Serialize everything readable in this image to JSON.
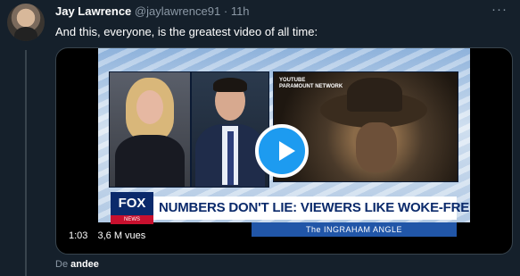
{
  "tweet": {
    "author_name": "Jay Lawrence",
    "author_handle": "@jaylawrence91",
    "separator": "·",
    "time": "11h",
    "more_icon": "more-horizontal-icon",
    "text": "And this, everyone, is the greatest video of all time:"
  },
  "video": {
    "duration": "1:03",
    "views": "3,6 M vues",
    "clip_label": "YOUTUBE\nPARAMOUNT NETWORK",
    "network_logo": "FOX",
    "network_sub": "NEWS",
    "headline": "NUMBERS DON'T LIE: VIEWERS LIKE WOKE-FREE TV",
    "show_name": "The INGRAHAM ANGLE",
    "play_icon": "play-icon"
  },
  "attribution": {
    "prefix": "De",
    "user": "andee"
  },
  "colors": {
    "background": "#15202b",
    "accent": "#1d9bf0",
    "muted_text": "#8b98a5"
  }
}
